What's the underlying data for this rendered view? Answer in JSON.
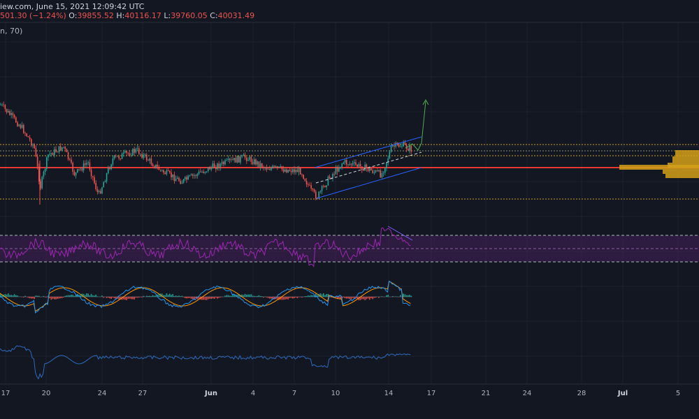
{
  "header": {
    "line1": "iew.com, June 15, 2021 12:09:42 UTC",
    "change": "501.30 (−1.24%)",
    "o_label": "O:",
    "o_value": "39855.52",
    "h_label": "H:",
    "h_value": "40116.17",
    "l_label": "L:",
    "l_value": "39760.05",
    "c_label": "C:",
    "c_value": "40031.49",
    "indicator_label": "n, 70)"
  },
  "colors": {
    "background": "#131722",
    "up": "#26a69a",
    "down": "#ef5350",
    "support": "#e53935",
    "channel": "#2962ff",
    "rsi": "#9c27b0",
    "rsi_band": "#4a1f5e",
    "macd": "#2196f3",
    "signal": "#ff9800",
    "target_arrow": "#4caf50",
    "volume_profile": "#d4a017",
    "bottom_line": "#2f6bbf"
  },
  "x_axis": {
    "ticks": [
      {
        "label": "17",
        "month": false
      },
      {
        "label": "20",
        "month": false
      },
      {
        "label": "24",
        "month": false
      },
      {
        "label": "27",
        "month": false
      },
      {
        "label": "Jun",
        "month": true
      },
      {
        "label": "4",
        "month": false
      },
      {
        "label": "7",
        "month": false
      },
      {
        "label": "10",
        "month": false
      },
      {
        "label": "14",
        "month": false
      },
      {
        "label": "17",
        "month": false
      },
      {
        "label": "21",
        "month": false
      },
      {
        "label": "24",
        "month": false
      },
      {
        "label": "28",
        "month": false
      },
      {
        "label": "Jul",
        "month": true
      },
      {
        "label": "5",
        "month": false
      }
    ]
  },
  "chart_data": {
    "type": "candlestick",
    "title": "",
    "xlabel": "",
    "ylabel": "",
    "visible_ohlc": {
      "open": 39855.52,
      "high": 40116.17,
      "low": 39760.05,
      "close": 40031.49,
      "change": "501.30 (−1.24%)"
    },
    "drawn_levels": [
      "dotted resistance upper",
      "dotted resistance lower",
      "red support line",
      "dotted low line"
    ],
    "indicators": [
      "RSI with band",
      "MACD with histogram",
      "line indicator"
    ],
    "grid": true,
    "legend": "none"
  }
}
